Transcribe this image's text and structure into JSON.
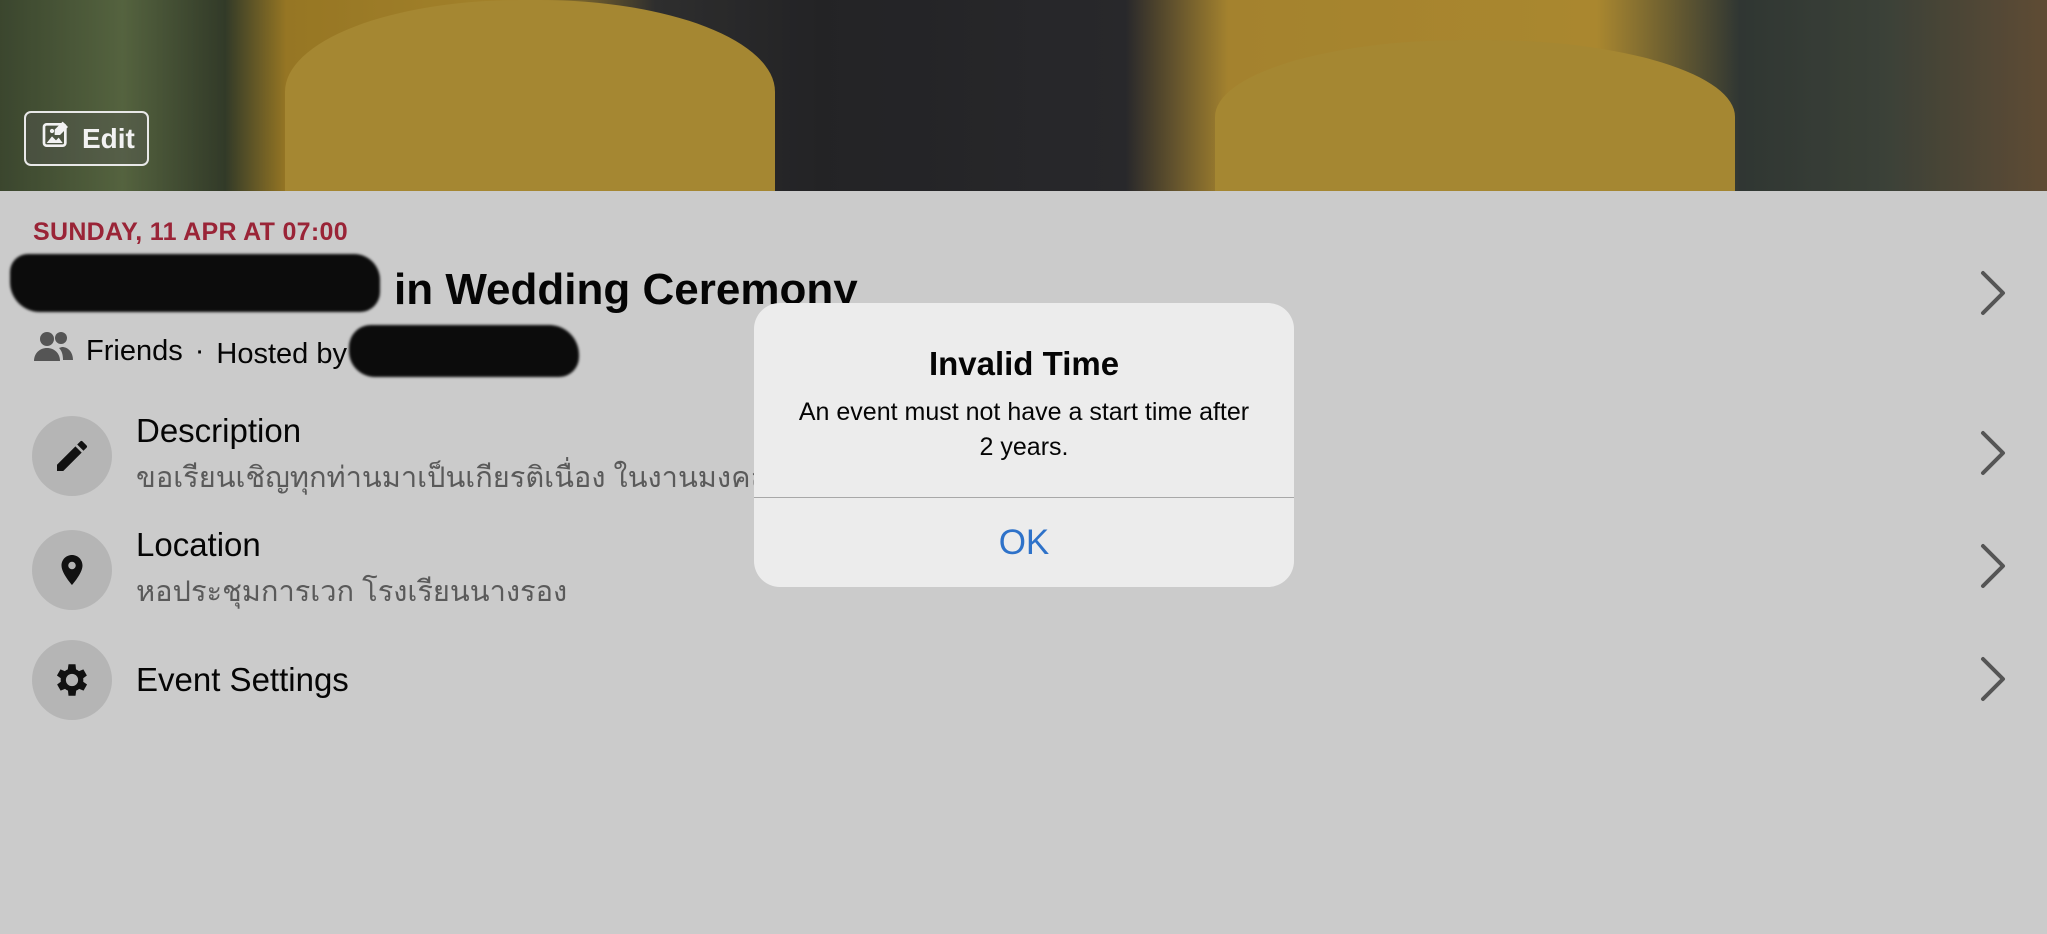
{
  "cover": {
    "edit_label": "Edit"
  },
  "event": {
    "date": "SUNDAY, 11 APR AT 07:00",
    "title_suffix": "in Wedding Ceremony",
    "privacy": "Friends",
    "separator": "·",
    "hosted_by_prefix": "Hosted by"
  },
  "rows": [
    {
      "title": "Description",
      "subtitle": "ขอเรียนเชิญทุกท่านมาเป็นเกียรติเนื่อง ในงานมงคลส",
      "icon": "pencil-icon"
    },
    {
      "title": "Location",
      "subtitle": "หอประชุมการเวก โรงเรียนนางรอง",
      "icon": "map-pin-icon"
    },
    {
      "title": "Event Settings",
      "subtitle": "",
      "icon": "gear-icon"
    }
  ],
  "alert": {
    "title": "Invalid Time",
    "message": "An event must not have a start time after 2 years.",
    "ok_label": "OK"
  },
  "colors": {
    "date_red": "#9a2437",
    "link_blue": "#2e72c9",
    "backdrop": "#cbcbcb"
  }
}
